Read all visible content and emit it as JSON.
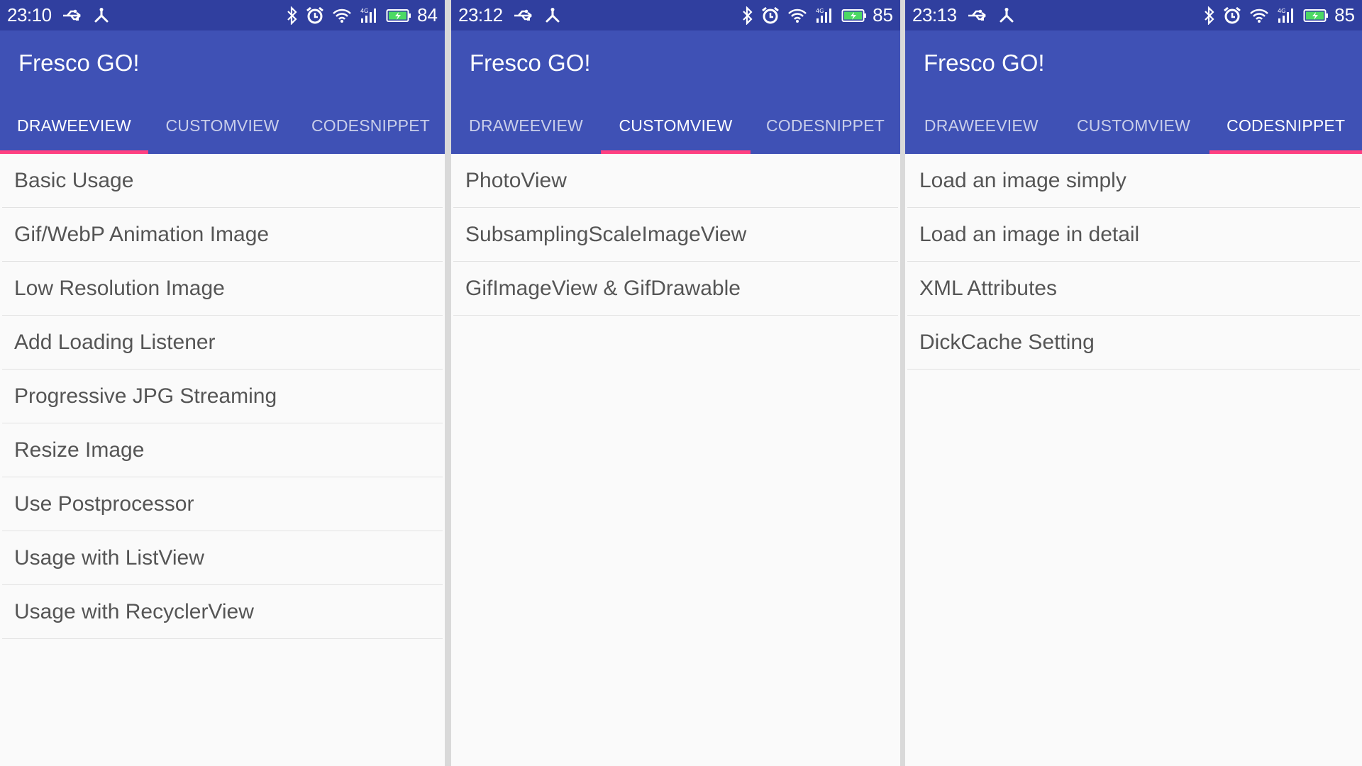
{
  "colors": {
    "status_bar": "#303f9f",
    "app_bar": "#3f51b5",
    "tab_indicator": "#ff4081",
    "background": "#fafafa",
    "divider": "#e2e2e2",
    "item_text": "#555555"
  },
  "screens": [
    {
      "status": {
        "time": "23:10",
        "battery": "84",
        "icons_left": [
          "usb-icon",
          "debug-icon"
        ],
        "icons_right": [
          "bluetooth-icon",
          "alarm-icon",
          "wifi-icon",
          "signal-4g-icon",
          "battery-icon"
        ]
      },
      "title": "Fresco GO!",
      "tabs": [
        {
          "label": "DRAWEEVIEW",
          "active": true
        },
        {
          "label": "CUSTOMVIEW",
          "active": false
        },
        {
          "label": "CODESNIPPET",
          "active": false
        }
      ],
      "items": [
        "Basic Usage",
        "Gif/WebP Animation Image",
        "Low Resolution Image",
        "Add Loading Listener",
        "Progressive JPG Streaming",
        "Resize Image",
        "Use Postprocessor",
        "Usage with ListView",
        "Usage with RecyclerView"
      ]
    },
    {
      "status": {
        "time": "23:12",
        "battery": "85",
        "icons_left": [
          "usb-icon",
          "debug-icon"
        ],
        "icons_right": [
          "bluetooth-icon",
          "alarm-icon",
          "wifi-icon",
          "signal-4g-icon",
          "battery-icon"
        ]
      },
      "title": "Fresco GO!",
      "tabs": [
        {
          "label": "DRAWEEVIEW",
          "active": false
        },
        {
          "label": "CUSTOMVIEW",
          "active": true
        },
        {
          "label": "CODESNIPPET",
          "active": false
        }
      ],
      "items": [
        "PhotoView",
        "SubsamplingScaleImageView",
        "GifImageView & GifDrawable"
      ]
    },
    {
      "status": {
        "time": "23:13",
        "battery": "85",
        "icons_left": [
          "usb-icon",
          "debug-icon"
        ],
        "icons_right": [
          "bluetooth-icon",
          "alarm-icon",
          "wifi-icon",
          "signal-4g-icon",
          "battery-icon"
        ]
      },
      "title": "Fresco GO!",
      "tabs": [
        {
          "label": "DRAWEEVIEW",
          "active": false
        },
        {
          "label": "CUSTOMVIEW",
          "active": false
        },
        {
          "label": "CODESNIPPET",
          "active": true
        }
      ],
      "items": [
        "Load an image simply",
        "Load an image in detail",
        "XML Attributes",
        "DickCache Setting"
      ]
    }
  ]
}
